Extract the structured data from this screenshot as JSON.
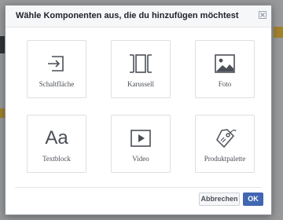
{
  "dialog": {
    "title": "Wähle Komponenten aus, die du hinzufügen möchtest",
    "close_icon": "close-icon"
  },
  "components": [
    {
      "label": "Schaltfläche",
      "icon": "button-arrow-icon"
    },
    {
      "label": "Karussell",
      "icon": "carousel-icon"
    },
    {
      "label": "Foto",
      "icon": "photo-icon"
    },
    {
      "label": "Textblock",
      "icon": "text-aa-icon",
      "glyph": "Aa"
    },
    {
      "label": "Video",
      "icon": "video-play-icon"
    },
    {
      "label": "Produktpalette",
      "icon": "product-tag-icon"
    }
  ],
  "footer": {
    "cancel_label": "Abbrechen",
    "ok_label": "OK"
  },
  "colors": {
    "primary": "#4267b2",
    "icon": "#4b4f56",
    "tile_border": "#dddfe2"
  }
}
